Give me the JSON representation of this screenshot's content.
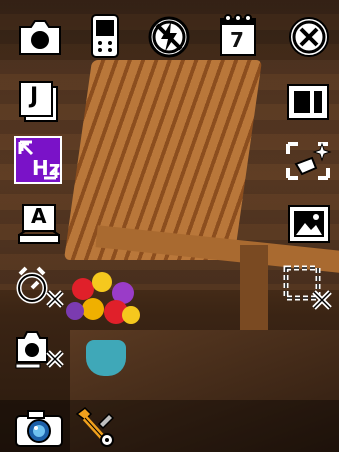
{
  "status_bar": {
    "calendar_day": "7"
  },
  "left_menu": {
    "frequency_label": "Hz",
    "scene_letter": "A",
    "quality_letter": "J"
  },
  "colors": {
    "accent": "#7a12c8",
    "icon_fill": "#ffffff",
    "icon_outline": "#000000"
  }
}
